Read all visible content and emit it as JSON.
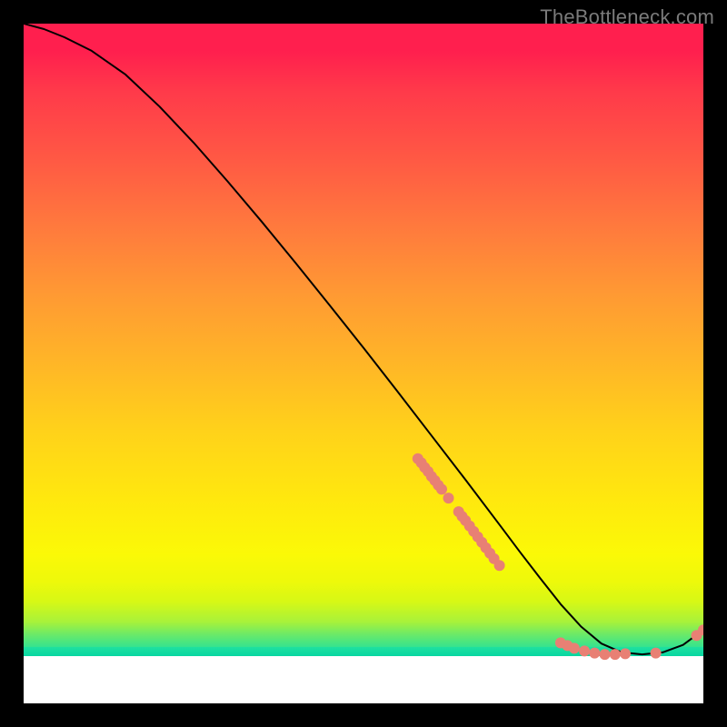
{
  "watermark": "TheBottleneck.com",
  "chart_data": {
    "type": "line",
    "title": "",
    "xlabel": "",
    "ylabel": "",
    "xlim": [
      0,
      100
    ],
    "ylim": [
      0,
      100
    ],
    "curve": {
      "x": [
        0,
        3,
        6,
        10,
        15,
        20,
        25,
        30,
        35,
        40,
        45,
        50,
        55,
        60,
        65,
        70,
        73,
        76,
        79,
        82,
        85,
        88,
        91,
        94,
        97,
        100
      ],
      "y": [
        100,
        99.2,
        98.0,
        96.0,
        92.5,
        87.8,
        82.5,
        76.8,
        70.9,
        64.8,
        58.6,
        52.3,
        45.9,
        39.4,
        32.9,
        26.3,
        22.3,
        18.4,
        14.6,
        11.3,
        8.8,
        7.5,
        7.2,
        7.5,
        8.6,
        10.8
      ]
    },
    "points": [
      {
        "x": 58.0,
        "y": 36.0
      },
      {
        "x": 58.5,
        "y": 35.4
      },
      {
        "x": 59.0,
        "y": 34.7
      },
      {
        "x": 59.5,
        "y": 34.1
      },
      {
        "x": 60.0,
        "y": 33.4
      },
      {
        "x": 60.5,
        "y": 32.8
      },
      {
        "x": 61.0,
        "y": 32.1
      },
      {
        "x": 61.5,
        "y": 31.5
      },
      {
        "x": 62.5,
        "y": 30.2
      },
      {
        "x": 64.0,
        "y": 28.2
      },
      {
        "x": 64.5,
        "y": 27.5
      },
      {
        "x": 65.0,
        "y": 26.9
      },
      {
        "x": 65.6,
        "y": 26.1
      },
      {
        "x": 66.2,
        "y": 25.3
      },
      {
        "x": 66.8,
        "y": 24.5
      },
      {
        "x": 67.4,
        "y": 23.7
      },
      {
        "x": 68.0,
        "y": 22.9
      },
      {
        "x": 68.6,
        "y": 22.1
      },
      {
        "x": 69.2,
        "y": 21.3
      },
      {
        "x": 70.0,
        "y": 20.3
      },
      {
        "x": 79.0,
        "y": 8.9
      },
      {
        "x": 80.0,
        "y": 8.5
      },
      {
        "x": 81.0,
        "y": 8.1
      },
      {
        "x": 82.5,
        "y": 7.7
      },
      {
        "x": 84.0,
        "y": 7.4
      },
      {
        "x": 85.5,
        "y": 7.2
      },
      {
        "x": 87.0,
        "y": 7.2
      },
      {
        "x": 88.5,
        "y": 7.3
      },
      {
        "x": 93.0,
        "y": 7.4
      },
      {
        "x": 99.0,
        "y": 10.0
      },
      {
        "x": 100.0,
        "y": 10.8
      }
    ],
    "point_color": "#e88074",
    "curve_color": "#000000"
  }
}
